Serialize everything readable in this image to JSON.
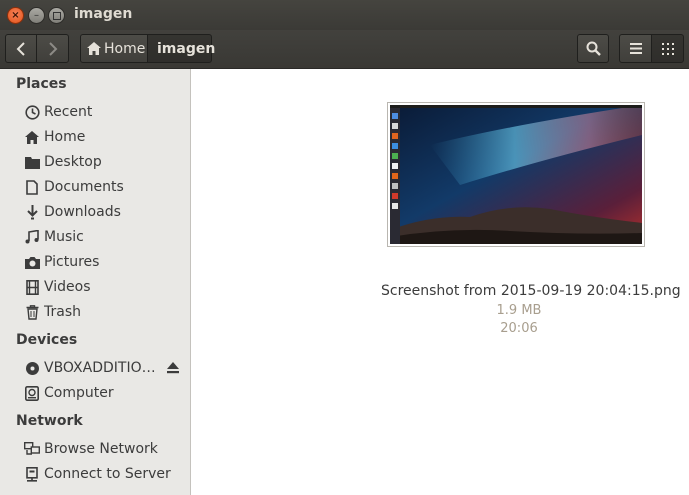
{
  "window": {
    "title": "imagen"
  },
  "toolbar": {
    "breadcrumb": [
      {
        "label": "Home",
        "icon": "home-icon"
      },
      {
        "label": "imagen"
      }
    ]
  },
  "sidebar": {
    "places_header": "Places",
    "places": [
      {
        "label": "Recent",
        "icon": "clock-icon"
      },
      {
        "label": "Home",
        "icon": "home-icon"
      },
      {
        "label": "Desktop",
        "icon": "folder-icon"
      },
      {
        "label": "Documents",
        "icon": "document-icon"
      },
      {
        "label": "Downloads",
        "icon": "download-icon"
      },
      {
        "label": "Music",
        "icon": "music-icon"
      },
      {
        "label": "Pictures",
        "icon": "camera-icon"
      },
      {
        "label": "Videos",
        "icon": "film-icon"
      },
      {
        "label": "Trash",
        "icon": "trash-icon"
      }
    ],
    "devices_header": "Devices",
    "devices": [
      {
        "label": "VBOXADDITIO…",
        "icon": "disc-icon"
      },
      {
        "label": "Computer",
        "icon": "harddrive-icon"
      }
    ],
    "network_header": "Network",
    "network": [
      {
        "label": "Browse Network",
        "icon": "network-icon"
      },
      {
        "label": "Connect to Server",
        "icon": "server-icon"
      }
    ]
  },
  "files": [
    {
      "name": "Screenshot from 2015-09-19 20:04:15.png",
      "size": "1.9 MB",
      "time": "20:06"
    }
  ],
  "colors": {
    "accent": "#e25318",
    "sidebar_bg": "#e9e8e5",
    "toolbar_bg": "#3c3b37",
    "meta_text": "#a89e8e"
  }
}
